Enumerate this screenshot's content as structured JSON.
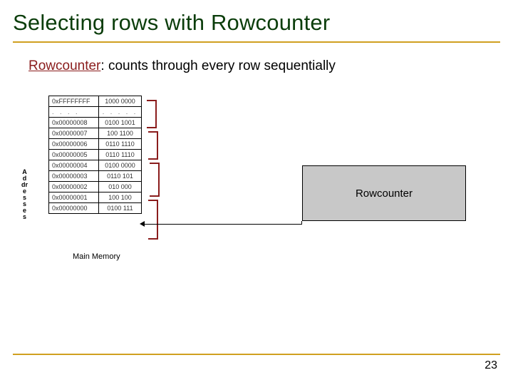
{
  "title": "Selecting rows with Rowcounter",
  "subtitle": {
    "first": "Rowcounter",
    "rest": ": counts through every row sequentially"
  },
  "addresses_label": "Addresses",
  "memory": {
    "caption": "Main Memory",
    "dots_addr": ". . . .",
    "dots_data": ". . . . .",
    "rows": [
      {
        "addr": "0xFFFFFFFF",
        "data": "1000 0000"
      },
      {
        "addr": "0x00000008",
        "data": "0100 1001"
      },
      {
        "addr": "0x00000007",
        "data": "100 1100"
      },
      {
        "addr": "0x00000006",
        "data": "0110 1110"
      },
      {
        "addr": "0x00000005",
        "data": "0110 1110"
      },
      {
        "addr": "0x00000004",
        "data": "0100 0000"
      },
      {
        "addr": "0x00000003",
        "data": "0110 101"
      },
      {
        "addr": "0x00000002",
        "data": "010  000"
      },
      {
        "addr": "0x00000001",
        "data": "100 100"
      },
      {
        "addr": "0x00000000",
        "data": "0100 111"
      }
    ]
  },
  "rowcounter_label": "Rowcounter",
  "page_number": "23"
}
